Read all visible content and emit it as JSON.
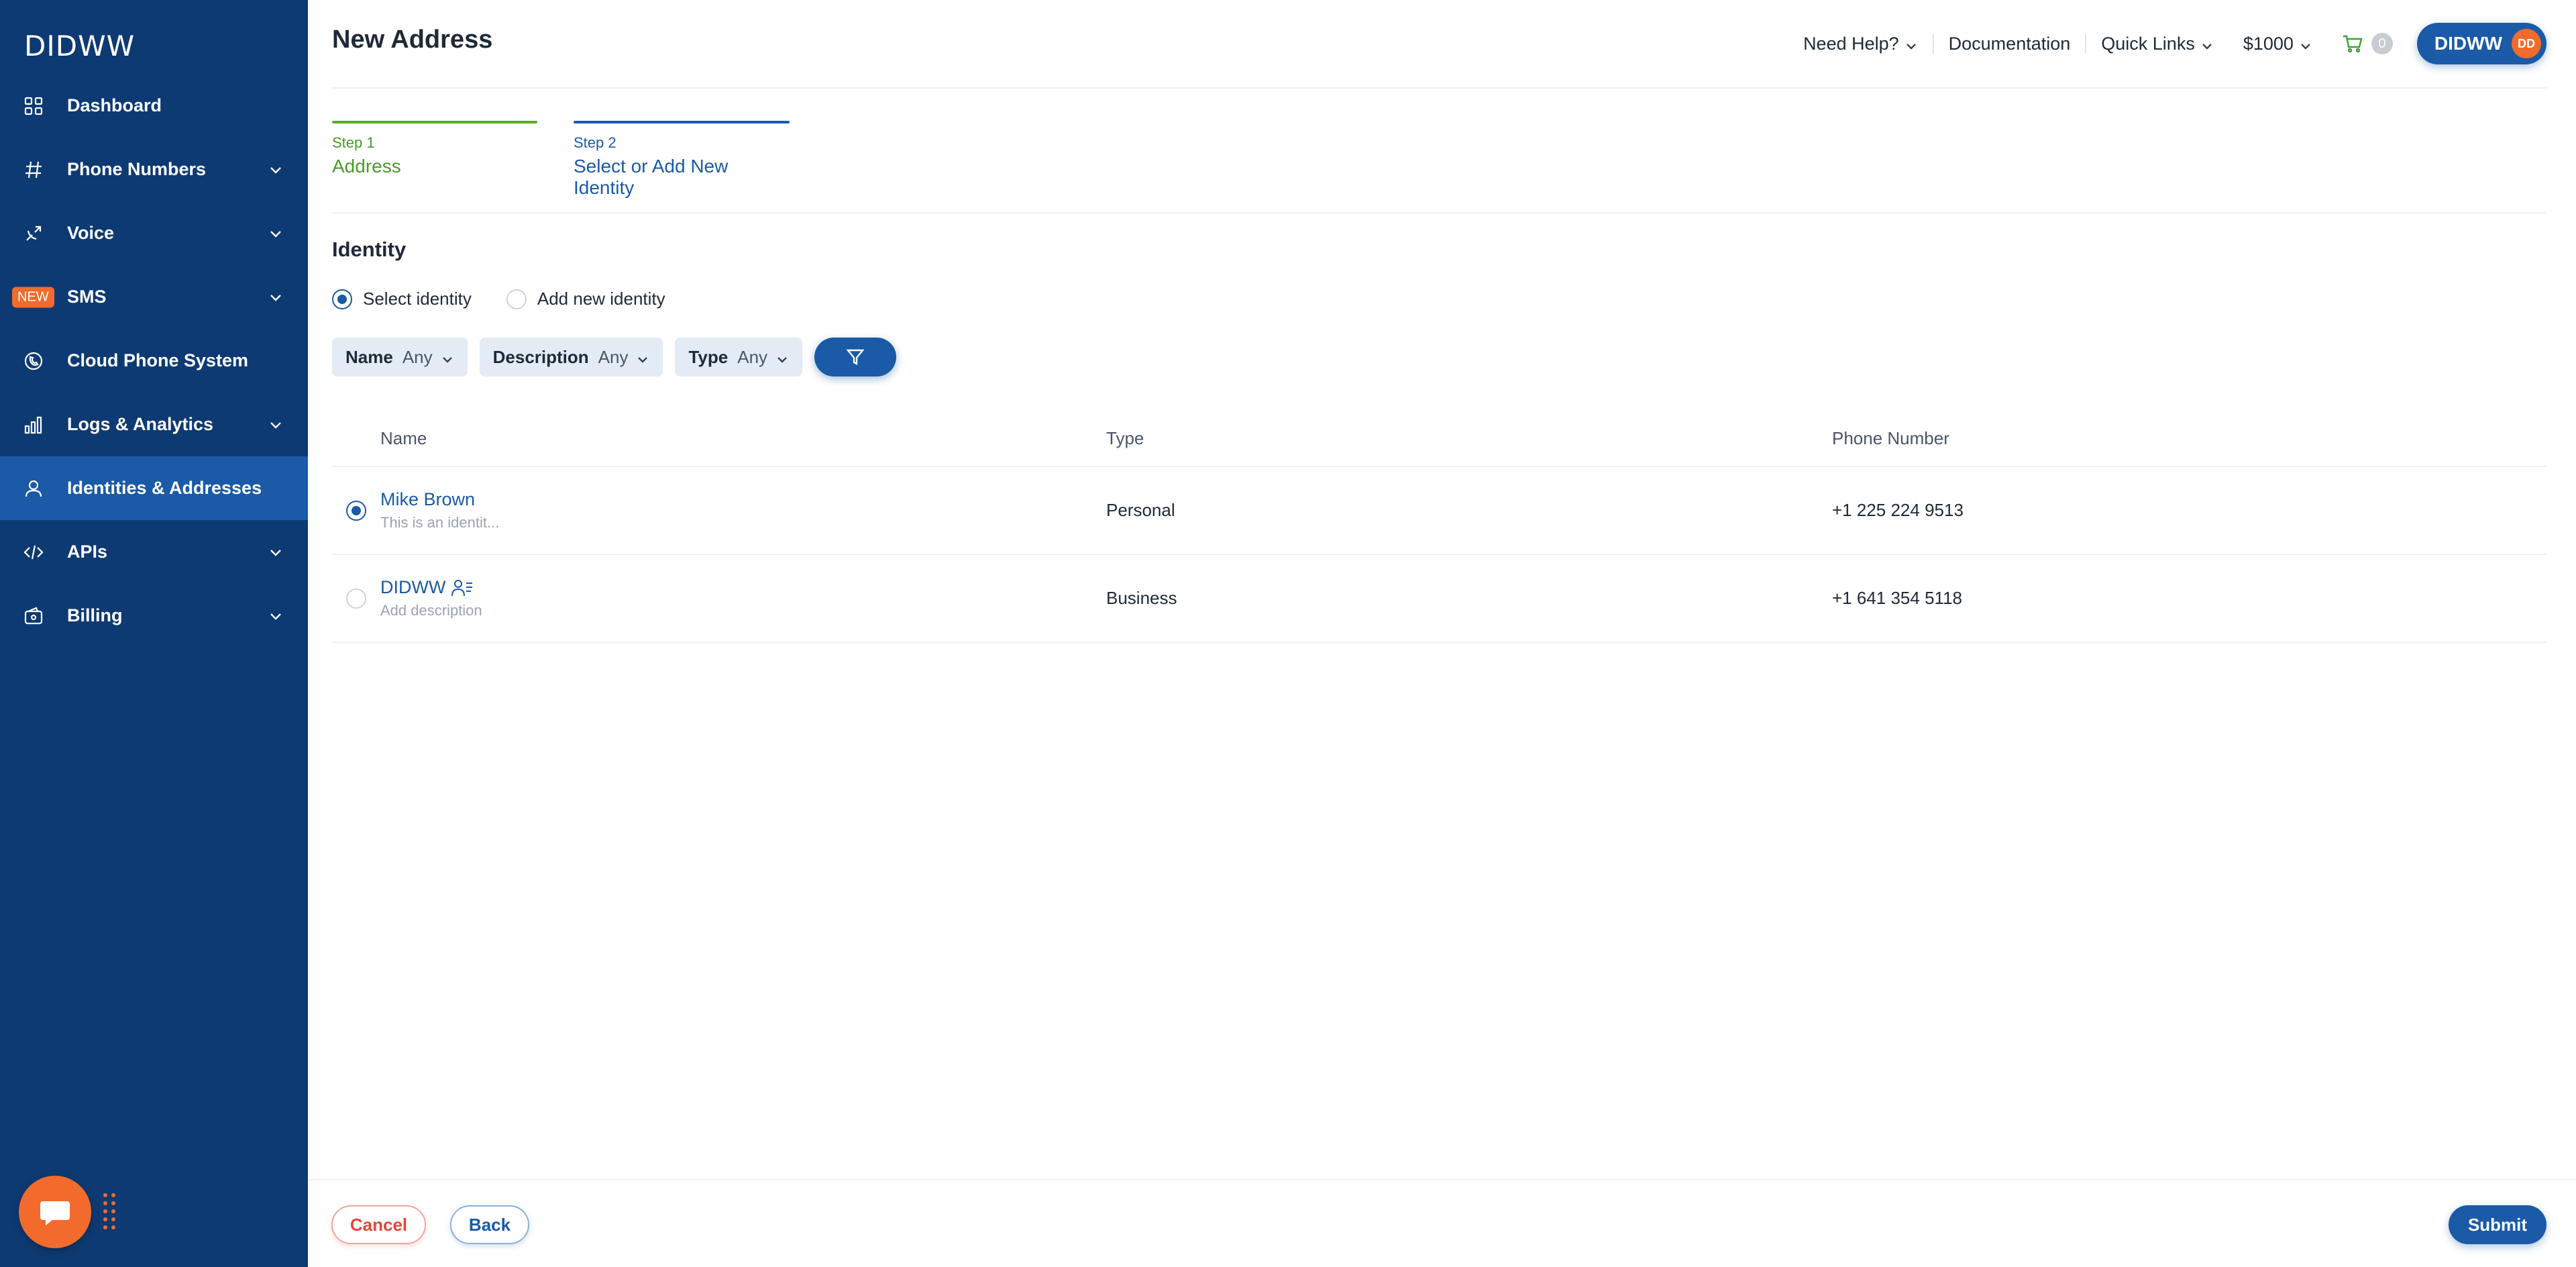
{
  "brand": {
    "logo_text": "DIDWW",
    "accent": "#1a5aa6",
    "sidebar_bg": "#0e3a73",
    "orange": "#f26b2c",
    "green": "#5aa832"
  },
  "sidebar": {
    "items": [
      {
        "label": "Dashboard",
        "icon": "grid-icon",
        "expandable": false
      },
      {
        "label": "Phone Numbers",
        "icon": "hash-icon",
        "expandable": true
      },
      {
        "label": "Voice",
        "icon": "phone-forward-icon",
        "expandable": true
      },
      {
        "label": "SMS",
        "icon": "sms-icon",
        "expandable": true,
        "badge": "NEW"
      },
      {
        "label": "Cloud Phone System",
        "icon": "cloud-phone-icon",
        "expandable": false
      },
      {
        "label": "Logs & Analytics",
        "icon": "bar-chart-icon",
        "expandable": true
      },
      {
        "label": "Identities & Addresses",
        "icon": "user-icon",
        "expandable": false,
        "active": true
      },
      {
        "label": "APIs",
        "icon": "code-icon",
        "expandable": true
      },
      {
        "label": "Billing",
        "icon": "wallet-icon",
        "expandable": true
      }
    ]
  },
  "header": {
    "title": "New Address",
    "need_help": "Need Help?",
    "documentation": "Documentation",
    "quick_links": "Quick Links",
    "balance": "$1000",
    "cart_count": "0",
    "user_name": "DIDWW",
    "avatar_initials": "DD"
  },
  "stepper": {
    "steps": [
      {
        "num": "Step 1",
        "label": "Address",
        "state": "complete"
      },
      {
        "num": "Step 2",
        "label": "Select or Add New Identity",
        "state": "current"
      }
    ]
  },
  "identity": {
    "title": "Identity",
    "options": [
      {
        "label": "Select identity",
        "checked": true
      },
      {
        "label": "Add new identity",
        "checked": false
      }
    ],
    "filters": [
      {
        "name": "Name",
        "value": "Any"
      },
      {
        "name": "Description",
        "value": "Any"
      },
      {
        "name": "Type",
        "value": "Any"
      }
    ]
  },
  "table": {
    "columns": [
      "Name",
      "Type",
      "Phone Number"
    ],
    "rows": [
      {
        "name": "Mike Brown",
        "description": "This is an identit...",
        "type": "Personal",
        "phone": "+1 225 224 9513",
        "selected": true,
        "verified_icon": false
      },
      {
        "name": "DIDWW",
        "description": "Add description",
        "type": "Business",
        "phone": "+1 641 354 5118",
        "selected": false,
        "verified_icon": true
      }
    ]
  },
  "footer": {
    "cancel": "Cancel",
    "back": "Back",
    "submit": "Submit"
  }
}
